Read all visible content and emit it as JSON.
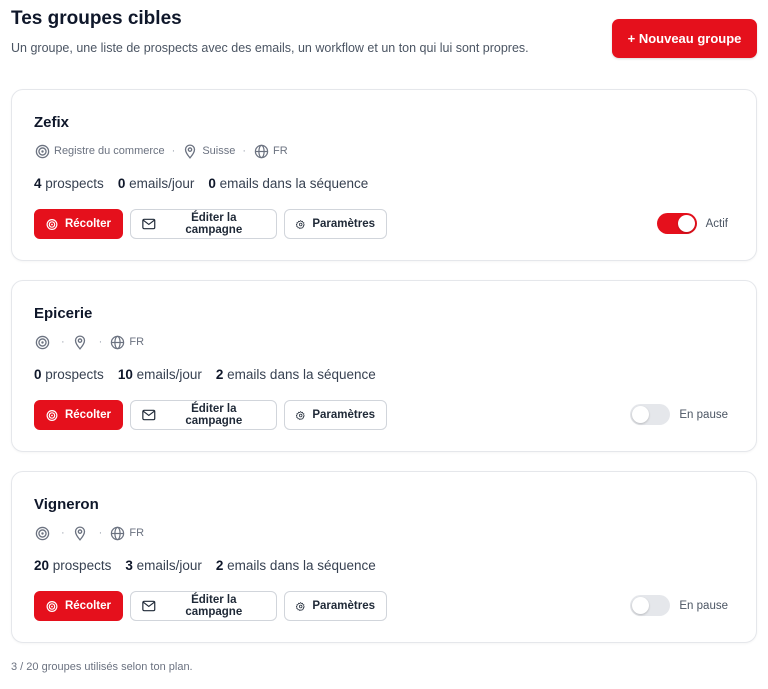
{
  "header": {
    "title": "Tes groupes cibles",
    "subtitle": "Un groupe, une liste de prospects avec des emails, un workflow et un ton qui lui sont propres.",
    "new_group_label": "+ Nouveau groupe"
  },
  "colors": {
    "accent": "#e5101c",
    "muted": "#6b7280",
    "border": "#e5e7eb"
  },
  "icons": {
    "source": "target-icon",
    "location": "map-pin-icon",
    "language": "globe-icon",
    "collect": "target-icon",
    "edit": "mail-icon",
    "settings": "gear-icon"
  },
  "groups": [
    {
      "name": "Zefix",
      "source": "Registre du commerce",
      "location": "Suisse",
      "language": "FR",
      "prospects": "4",
      "prospects_label": "prospects",
      "emails_per_day": "0",
      "emails_per_day_label": "emails/jour",
      "sequence_emails": "0",
      "sequence_label": "emails dans la séquence",
      "collect_label": "Récolter",
      "edit_label": "Éditer la campagne",
      "settings_label": "Paramètres",
      "active": true,
      "status_label": "Actif"
    },
    {
      "name": "Epicerie",
      "source": "",
      "location": "",
      "language": "FR",
      "prospects": "0",
      "prospects_label": "prospects",
      "emails_per_day": "10",
      "emails_per_day_label": "emails/jour",
      "sequence_emails": "2",
      "sequence_label": "emails dans la séquence",
      "collect_label": "Récolter",
      "edit_label": "Éditer la campagne",
      "settings_label": "Paramètres",
      "active": false,
      "status_label": "En pause"
    },
    {
      "name": "Vigneron",
      "source": "",
      "location": "",
      "language": "FR",
      "prospects": "20",
      "prospects_label": "prospects",
      "emails_per_day": "3",
      "emails_per_day_label": "emails/jour",
      "sequence_emails": "2",
      "sequence_label": "emails dans la séquence",
      "collect_label": "Récolter",
      "edit_label": "Éditer la campagne",
      "settings_label": "Paramètres",
      "active": false,
      "status_label": "En pause"
    }
  ],
  "footer": {
    "usage_note": "3 / 20 groupes utilisés selon ton plan."
  }
}
